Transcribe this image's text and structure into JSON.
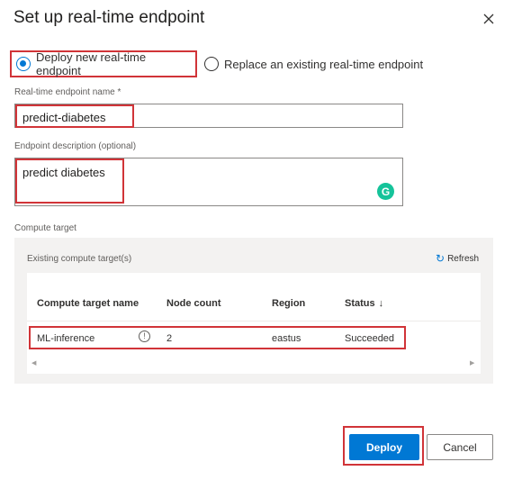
{
  "dialog": {
    "title": "Set up real-time endpoint",
    "close_icon": "close-icon"
  },
  "deployment_mode": {
    "options": [
      {
        "label": "Deploy new real-time endpoint",
        "selected": true
      },
      {
        "label": "Replace an existing real-time endpoint",
        "selected": false
      }
    ]
  },
  "endpoint_name": {
    "label": "Real-time endpoint name *",
    "value": "predict-diabetes"
  },
  "endpoint_description": {
    "label": "Endpoint description (optional)",
    "value": "predict diabetes",
    "grammarly_icon": "G"
  },
  "compute": {
    "label": "Compute target",
    "existing_label": "Existing compute target(s)",
    "refresh_label": "Refresh",
    "refresh_icon": "↻",
    "columns": [
      "Compute target name",
      "Node count",
      "Region",
      "Status"
    ],
    "sort_icon": "↓",
    "rows": [
      {
        "name": "ML-inference",
        "info_icon": "!",
        "node_count": "2",
        "region": "eastus",
        "status": "Succeeded"
      }
    ],
    "scroll_left": "◀",
    "scroll_right": "▶"
  },
  "actions": {
    "deploy_label": "Deploy",
    "cancel_label": "Cancel"
  },
  "colors": {
    "accent": "#0078d4",
    "highlight": "#d13438",
    "panel_bg": "#f3f2f1"
  }
}
